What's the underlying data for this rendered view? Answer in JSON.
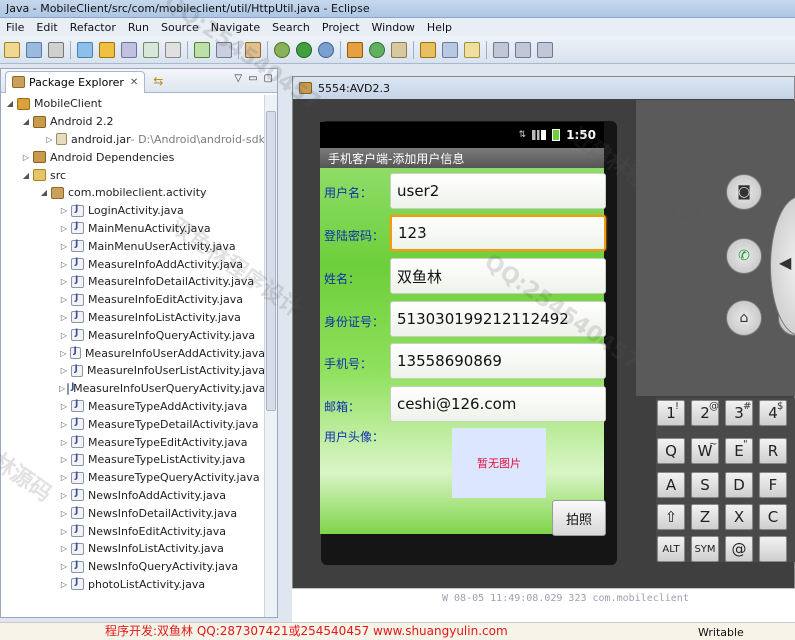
{
  "window": {
    "title": "Java - MobileClient/src/com/mobileclient/util/HttpUtil.java - Eclipse"
  },
  "menu": [
    "File",
    "Edit",
    "Refactor",
    "Run",
    "Source",
    "Navigate",
    "Search",
    "Project",
    "Window",
    "Help"
  ],
  "package_explorer": {
    "tab_label": "Package Explorer",
    "project": "MobileClient",
    "android_lib": "Android 2.2",
    "jar_name": "android.jar",
    "jar_path": " - D:\\Android\\android-sdk",
    "dependencies": "Android Dependencies",
    "src": "src",
    "package": "com.mobileclient.activity",
    "files": [
      "LoginActivity.java",
      "MainMenuActivity.java",
      "MainMenuUserActivity.java",
      "MeasureInfoAddActivity.java",
      "MeasureInfoDetailActivity.java",
      "MeasureInfoEditActivity.java",
      "MeasureInfoListActivity.java",
      "MeasureInfoQueryActivity.java",
      "MeasureInfoUserAddActivity.java",
      "MeasureInfoUserListActivity.java",
      "MeasureInfoUserQueryActivity.java",
      "MeasureTypeAddActivity.java",
      "MeasureTypeDetailActivity.java",
      "MeasureTypeEditActivity.java",
      "MeasureTypeListActivity.java",
      "MeasureTypeQueryActivity.java",
      "NewsInfoAddActivity.java",
      "NewsInfoDetailActivity.java",
      "NewsInfoEditActivity.java",
      "NewsInfoListActivity.java",
      "NewsInfoQueryActivity.java",
      "photoListActivity.java"
    ]
  },
  "emulator": {
    "title": "5554:AVD2.3",
    "time": "1:50",
    "app_title": "手机客户端-添加用户信息",
    "form": {
      "username_label": "用户名：",
      "username_value": "user2",
      "password_label": "登陆密码：",
      "password_value": "123",
      "name_label": "姓名：",
      "name_value": "双鱼林",
      "idcard_label": "身份证号：",
      "idcard_value": "513030199212112492",
      "phone_label": "手机号：",
      "phone_value": "13558690869",
      "email_label": "邮箱：",
      "email_value": "ceshi@126.com",
      "avatar_label": "用户头像：",
      "no_photo": "暂无图片",
      "photo_button": "拍照"
    },
    "keyboard_rows": [
      [
        "1",
        "2",
        "3",
        "4"
      ],
      [
        "Q",
        "W",
        "E",
        "R"
      ],
      [
        "A",
        "S",
        "D",
        "F"
      ],
      [
        "⇧",
        "Z",
        "X",
        "C"
      ],
      [
        "ALT",
        "SYM",
        "@",
        ""
      ]
    ],
    "key_hints": [
      "!",
      "@",
      "#",
      "$",
      "",
      "~",
      "\"",
      ""
    ]
  },
  "console": {
    "line": "W  08-05 11:49:08.029   323   com.mobileclient"
  },
  "footer": {
    "promo": "程序开发:双鱼林 QQ:287307421或254540457 www.shuangyulin.com",
    "status": "Writable"
  },
  "watermarks": [
    "QQ:254540457",
    "林源码",
    "双鱼林程序设计",
    "QQ:254540457",
    "近建林程序设计"
  ]
}
